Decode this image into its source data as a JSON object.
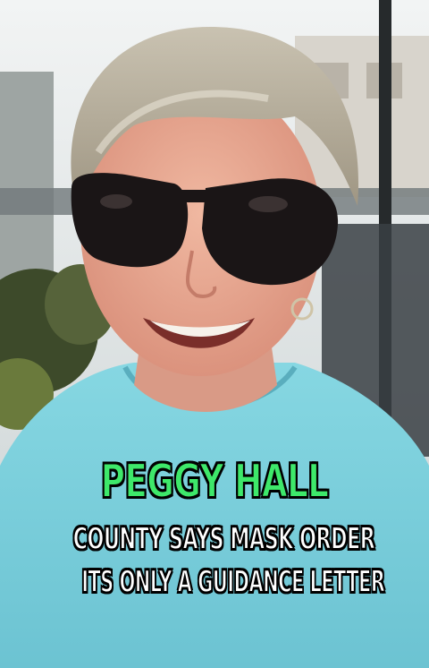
{
  "caption": {
    "name": "PEGGY HALL",
    "line1": "COUNTY SAYS MASK ORDER",
    "line2": "ITS ONLY A GUIDANCE LETTER"
  },
  "colors": {
    "name_text": "#3ee86a",
    "caption_text": "#ffffff",
    "shirt": "#7fd3df",
    "sky": "#e9eef0"
  }
}
